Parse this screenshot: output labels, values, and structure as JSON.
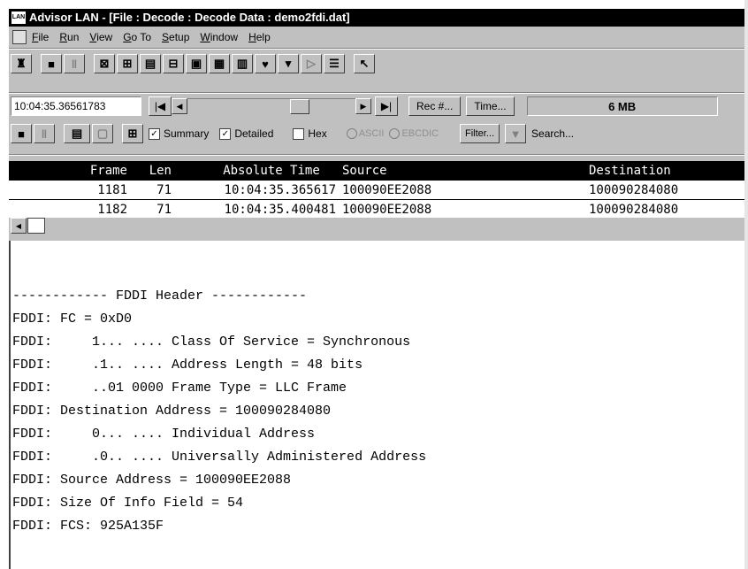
{
  "window": {
    "title": "Advisor LAN - [File : Decode : Decode Data : demo2fdi.dat]",
    "app_icon_text": "LAN"
  },
  "menu": [
    {
      "label": "File",
      "hotkey": "F"
    },
    {
      "label": "Run",
      "hotkey": "R"
    },
    {
      "label": "View",
      "hotkey": "V"
    },
    {
      "label": "Go To",
      "hotkey": "G"
    },
    {
      "label": "Setup",
      "hotkey": "S"
    },
    {
      "label": "Window",
      "hotkey": "W"
    },
    {
      "label": "Help",
      "hotkey": "H"
    }
  ],
  "toolbar": {
    "icons": [
      "run-icon",
      "stop-icon",
      "pause-icon",
      "capture-filter-icon",
      "trigger-icon",
      "statistics-icon",
      "decode-icon",
      "expert-icon",
      "network-icon",
      "chart-icon",
      "health-icon",
      "dropdown-icon",
      "playback-icon",
      "report-icon",
      "pointer-icon"
    ]
  },
  "navigation": {
    "timestamp": "10:04:35.36561783",
    "first_glyph": "|◀",
    "prev_glyph": "◀",
    "next_glyph": "▶",
    "last_glyph": "▶|",
    "rec_label": "Rec #...",
    "time_label": "Time...",
    "buffer_size": "6 MB"
  },
  "options": {
    "summary_label": "Summary",
    "summary_checked": true,
    "detailed_label": "Detailed",
    "detailed_checked": true,
    "hex_label": "Hex",
    "hex_checked": false,
    "ascii_label": "ASCII",
    "ebcdic_label": "EBCDIC",
    "filter_label": "Filter...",
    "search_label": "Search..."
  },
  "table": {
    "columns": [
      "Frame",
      "Len",
      "Absolute Time",
      "Source",
      "Destination"
    ],
    "rows": [
      {
        "frame": "1181",
        "len": "71",
        "time": "10:04:35.365617",
        "source": "100090EE2088",
        "destination": "100090284080"
      },
      {
        "frame": "1182",
        "len": "71",
        "time": "10:04:35.400481",
        "source": "100090EE2088",
        "destination": "100090284080"
      }
    ]
  },
  "detail": {
    "lines": [
      "------------ FDDI Header ------------",
      "FDDI: FC = 0xD0",
      "FDDI:     1... .... Class Of Service = Synchronous",
      "FDDI:     .1.. .... Address Length = 48 bits",
      "FDDI:     ..01 0000 Frame Type = LLC Frame",
      "FDDI: Destination Address = 100090284080",
      "FDDI:     0... .... Individual Address",
      "FDDI:     .0.. .... Universally Administered Address",
      "FDDI: Source Address = 100090EE2088",
      "FDDI: Size Of Info Field = 54",
      "FDDI: FCS: 925A135F"
    ]
  }
}
